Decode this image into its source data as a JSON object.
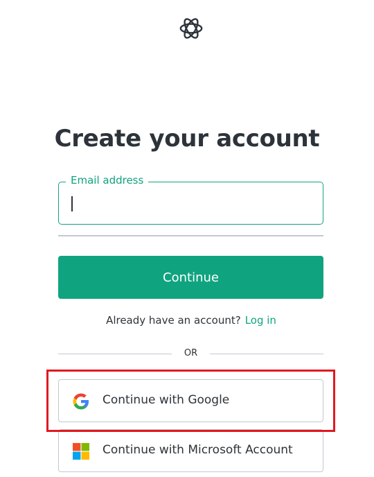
{
  "brand": {
    "logo_icon": "openai-logo-icon",
    "accent_color": "#10a37f"
  },
  "title": "Create your account",
  "email_field": {
    "label": "Email address",
    "value": "",
    "placeholder": ""
  },
  "continue_button": {
    "label": "Continue"
  },
  "login_prompt": {
    "text": "Already have an account?",
    "link_label": "Log in"
  },
  "separator": {
    "label": "OR"
  },
  "social_buttons": [
    {
      "label": "Continue with Google",
      "icon": "google-icon"
    },
    {
      "label": "Continue with Microsoft Account",
      "icon": "microsoft-icon"
    }
  ],
  "highlight": {
    "color": "#e0191f",
    "target": "Continue with Google"
  }
}
